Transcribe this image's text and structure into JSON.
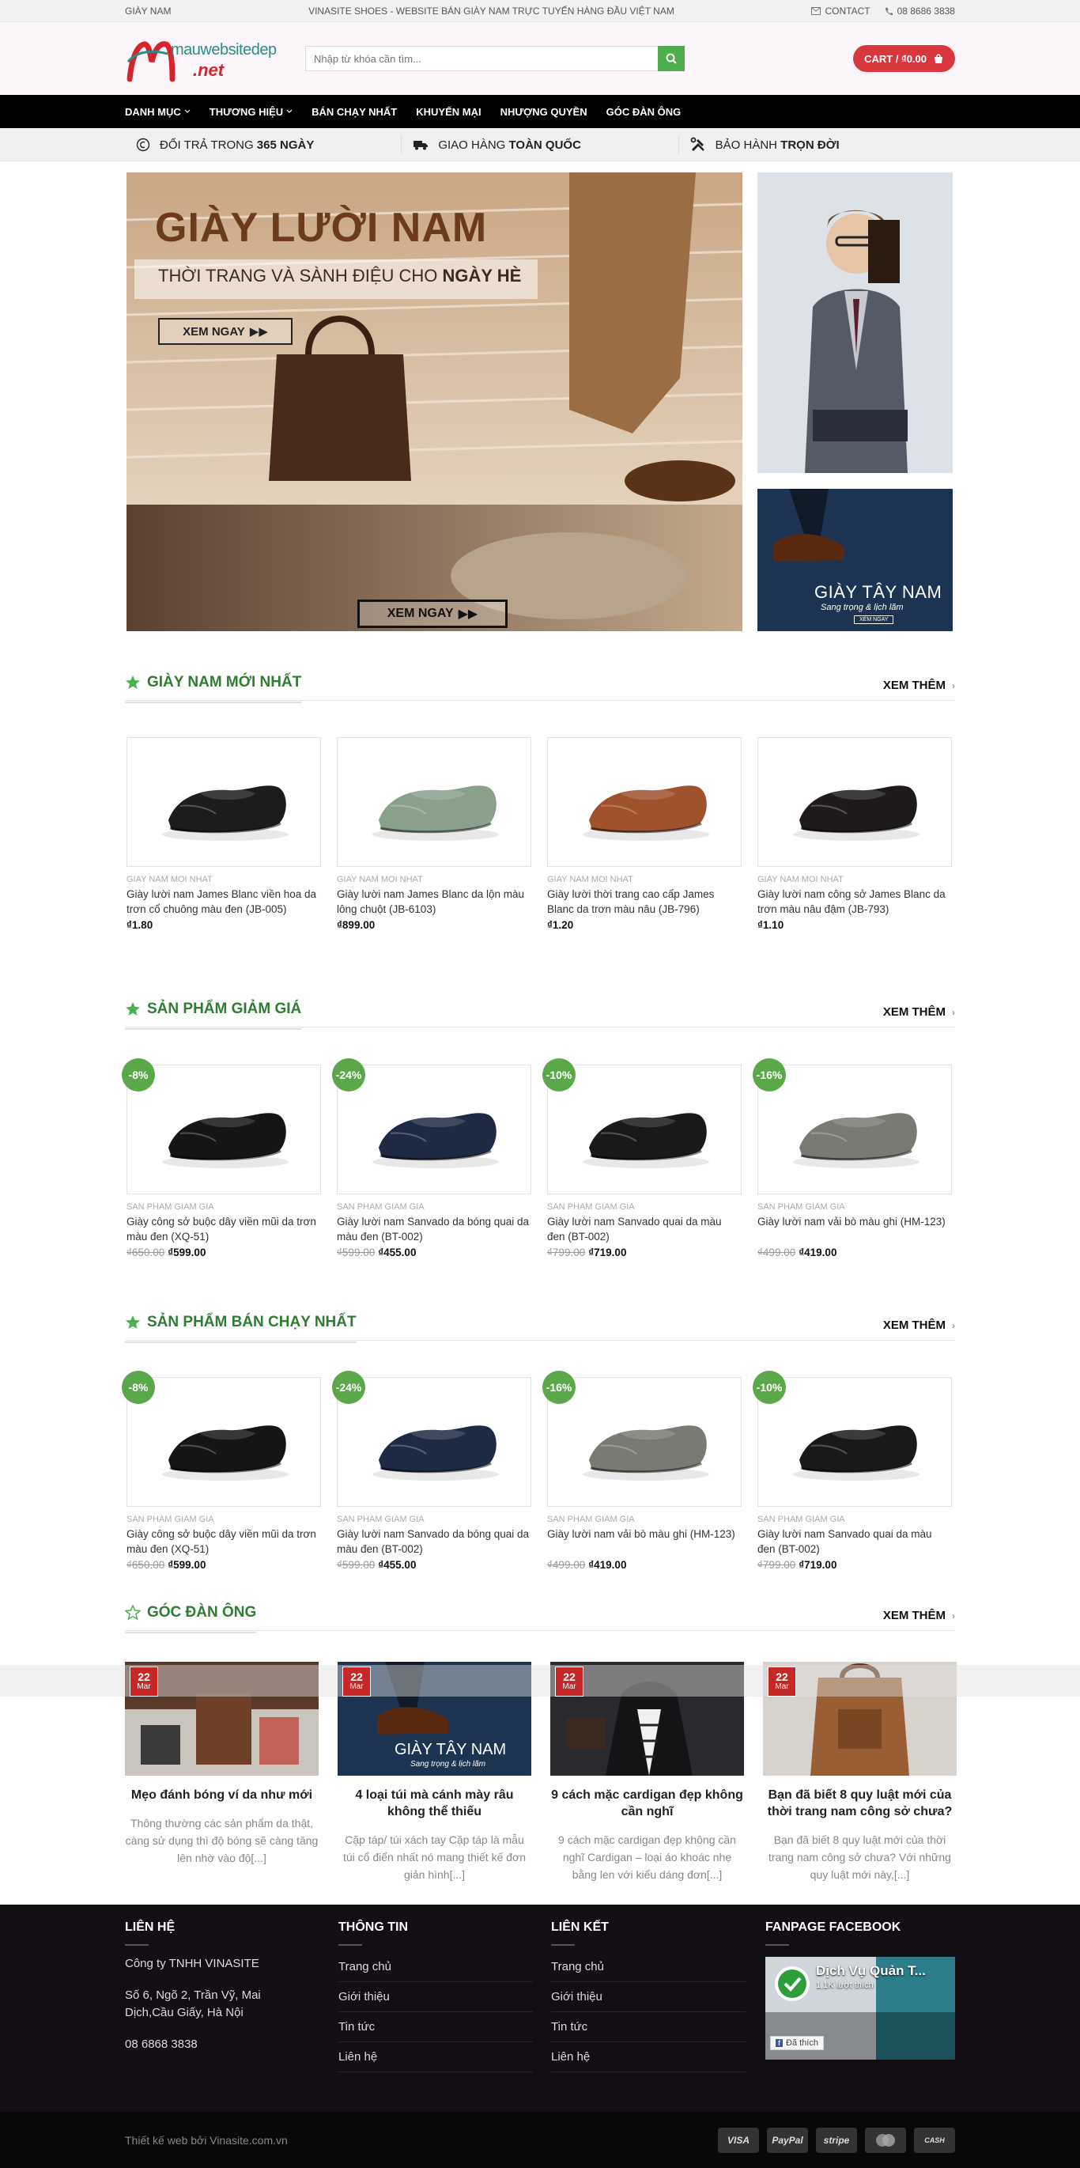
{
  "topbar": {
    "left": "GIÀY NAM",
    "center": "VINASITE SHOES - WEBSITE BÁN GIÀY NAM TRỰC TUYẾN HÀNG ĐẦU VIỆT NAM",
    "contact": "CONTACT",
    "phone": "08 8686 3838"
  },
  "header": {
    "logo_top": "mauwebsitedep",
    "logo_bottom": ".net",
    "search_placeholder": "Nhập từ khóa cần tìm...",
    "cart": "CART / ₫0.00"
  },
  "nav": [
    "DANH MỤC",
    "THƯƠNG HIỆU",
    "BÁN CHẠY NHẤT",
    "KHUYẾN MẠI",
    "NHƯỢNG QUYỀN",
    "GÓC ĐÀN ÔNG"
  ],
  "benefits": [
    {
      "pre": "ĐỔI TRẢ TRONG ",
      "bold": "365 NGÀY",
      "icon": "return-icon"
    },
    {
      "pre": "GIAO HÀNG ",
      "bold": "TOÀN QUỐC",
      "icon": "truck-icon"
    },
    {
      "pre": "BẢO HÀNH ",
      "bold": "TRỌN ĐỜI",
      "icon": "tools-icon"
    }
  ],
  "hero": {
    "title": "GIÀY LƯỜI NAM",
    "subtitle_pre": "THỜI TRANG VÀ SÀNH ĐIỆU CHO ",
    "subtitle_bold": "NGÀY HÈ",
    "button1": "XEM NGAY",
    "button2": "XEM NGAY",
    "side_title": "GIÀY TÂY NAM",
    "side_sub": "Sang trọng & lịch lãm",
    "side_btn": "XEM NGAY"
  },
  "more_label": "XEM THÊM",
  "section_new": {
    "title": "GIÀY NAM MỚI NHẤT",
    "products": [
      {
        "cat": "GIAY NAM MOI NHAT",
        "name": "Giày lười nam James Blanc viền hoa da trơn cổ chuông màu đen (JB-005)",
        "price": "₫1.80",
        "old": "",
        "color": "#1c1c1c"
      },
      {
        "cat": "GIAY NAM MOI NHAT",
        "name": "Giày lười nam James Blanc da lộn màu lông chuột (JB-6103)",
        "price": "₫899.00",
        "old": "",
        "color": "#8aa08a"
      },
      {
        "cat": "GIAY NAM MOI NHAT",
        "name": "Giày lười thời trang cao cấp James Blanc da trơn màu nâu (JB-796)",
        "price": "₫1.20",
        "old": "",
        "color": "#a0522d"
      },
      {
        "cat": "GIAY NAM MOI NHAT",
        "name": "Giày lười nam công sở James Blanc da trơn màu nâu đậm (JB-793)",
        "price": "₫1.10",
        "old": "",
        "color": "#1e1a1a"
      }
    ]
  },
  "section_sale": {
    "title": "SẢN PHẨM GIẢM GIÁ",
    "products": [
      {
        "badge": "-8%",
        "cat": "SAN PHAM GIAM GIA",
        "name": "Giày công sở buộc dây viền mũi da trơn màu đen (XQ-51)",
        "old": "₫650.00",
        "price": "₫599.00",
        "color": "#151515"
      },
      {
        "badge": "-24%",
        "cat": "SAN PHAM GIAM GIA",
        "name": "Giày lười nam Sanvado da bóng quai da màu đen (BT-002)",
        "old": "₫599.00",
        "price": "₫455.00",
        "color": "#1e2a44"
      },
      {
        "badge": "-10%",
        "cat": "SAN PHAM GIAM GIA",
        "name": "Giày lười nam Sanvado quai da màu đen (BT-002)",
        "old": "₫799.00",
        "price": "₫719.00",
        "color": "#191919"
      },
      {
        "badge": "-16%",
        "cat": "SAN PHAM GIAM GIA",
        "name": "Giày lười nam vải bò màu ghi (HM-123)",
        "old": "₫499.00",
        "price": "₫419.00",
        "color": "#7a7a72"
      }
    ]
  },
  "section_best": {
    "title": "SẢN PHẨM BÁN CHẠY NHẤT",
    "products": [
      {
        "badge": "-8%",
        "cat": "SAN PHAM GIAM GIA",
        "name": "Giày công sở buộc dây viền mũi da trơn màu đen (XQ-51)",
        "old": "₫650.00",
        "price": "₫599.00",
        "color": "#151515"
      },
      {
        "badge": "-24%",
        "cat": "SAN PHAM GIAM GIA",
        "name": "Giày lười nam Sanvado da bóng quai da màu đen (BT-002)",
        "old": "₫599.00",
        "price": "₫455.00",
        "color": "#1e2a44"
      },
      {
        "badge": "-16%",
        "cat": "SAN PHAM GIAM GIA",
        "name": "Giày lười nam vải bò màu ghi (HM-123)",
        "old": "₫499.00",
        "price": "₫419.00",
        "color": "#7a7a72"
      },
      {
        "badge": "-10%",
        "cat": "SAN PHAM GIAM GIA",
        "name": "Giày lười nam Sanvado quai da màu đen (BT-002)",
        "old": "₫799.00",
        "price": "₫719.00",
        "color": "#191919"
      }
    ]
  },
  "section_blog": {
    "title": "GÓC ĐÀN ÔNG",
    "posts": [
      {
        "day": "22",
        "month": "Mar",
        "title": "Mẹo đánh bóng ví da như mới",
        "excerpt": "Thông thường các sản phẩm da thật, càng sử dụng thì độ bóng sẽ càng tăng lên nhờ vào độ[...]",
        "img_text": "",
        "bg": "#6b4a3a"
      },
      {
        "day": "22",
        "month": "Mar",
        "title": "4 loại túi mà cánh mày râu không thể thiếu",
        "excerpt": "Cặp táp/ túi xách tay Cặp táp là mẫu túi cổ điển nhất nó mang thiết kế đơn giản hình[...]",
        "img_text": "GIÀY TÂY NAM",
        "img_sub": "Sang trọng & lịch lãm",
        "bg": "#1d3550"
      },
      {
        "day": "22",
        "month": "Mar",
        "title": "9 cách mặc cardigan đẹp không cần nghĩ",
        "excerpt": "9 cách mặc cardigan đẹp không cần nghĩ Cardigan – loại áo khoác nhẹ bằng len với kiểu dáng đơn[...]",
        "img_text": "",
        "bg": "#2a2a2e"
      },
      {
        "day": "22",
        "month": "Mar",
        "title": "Bạn đã biết 8 quy luật mới của thời trang nam công sở chưa?",
        "excerpt": "Bạn đã biết 8 quy luật mới của thời trang nam công sở chưa? Với những quy luật mới này,[...]",
        "img_text": "",
        "bg": "#b07a4e"
      }
    ]
  },
  "footer": {
    "contact_title": "LIÊN HỆ",
    "company": "Công ty TNHH VINASITE",
    "address": "Số 6, Ngõ 2, Trần Vỹ, Mai Dịch,Cầu Giấy, Hà Nội",
    "phone": "08 6868 3838",
    "info_title": "THÔNG TIN",
    "info_links": [
      "Trang chủ",
      "Giới thiệu",
      "Tin tức",
      "Liên hệ"
    ],
    "link_title": "LIÊN KẾT",
    "link_links": [
      "Trang chủ",
      "Giới thiệu",
      "Tin tức",
      "Liên hệ"
    ],
    "fb_title": "FANPAGE FACEBOOK",
    "fb_name": "Dịch Vụ Quản T...",
    "fb_likes": "1,1K lượt thích",
    "fb_like_btn": "Đã thích",
    "copyright": "Thiết kế web bởi Vinasite.com.vn",
    "payments": [
      "VISA",
      "PayPal",
      "stripe",
      "MC",
      "CASH"
    ]
  },
  "colors": {
    "accent_green": "#2e7d32",
    "badge_green": "#5ba84a",
    "cart_red": "#d9363e",
    "nav_bg": "#000000",
    "footer_bg": "#130d14"
  }
}
